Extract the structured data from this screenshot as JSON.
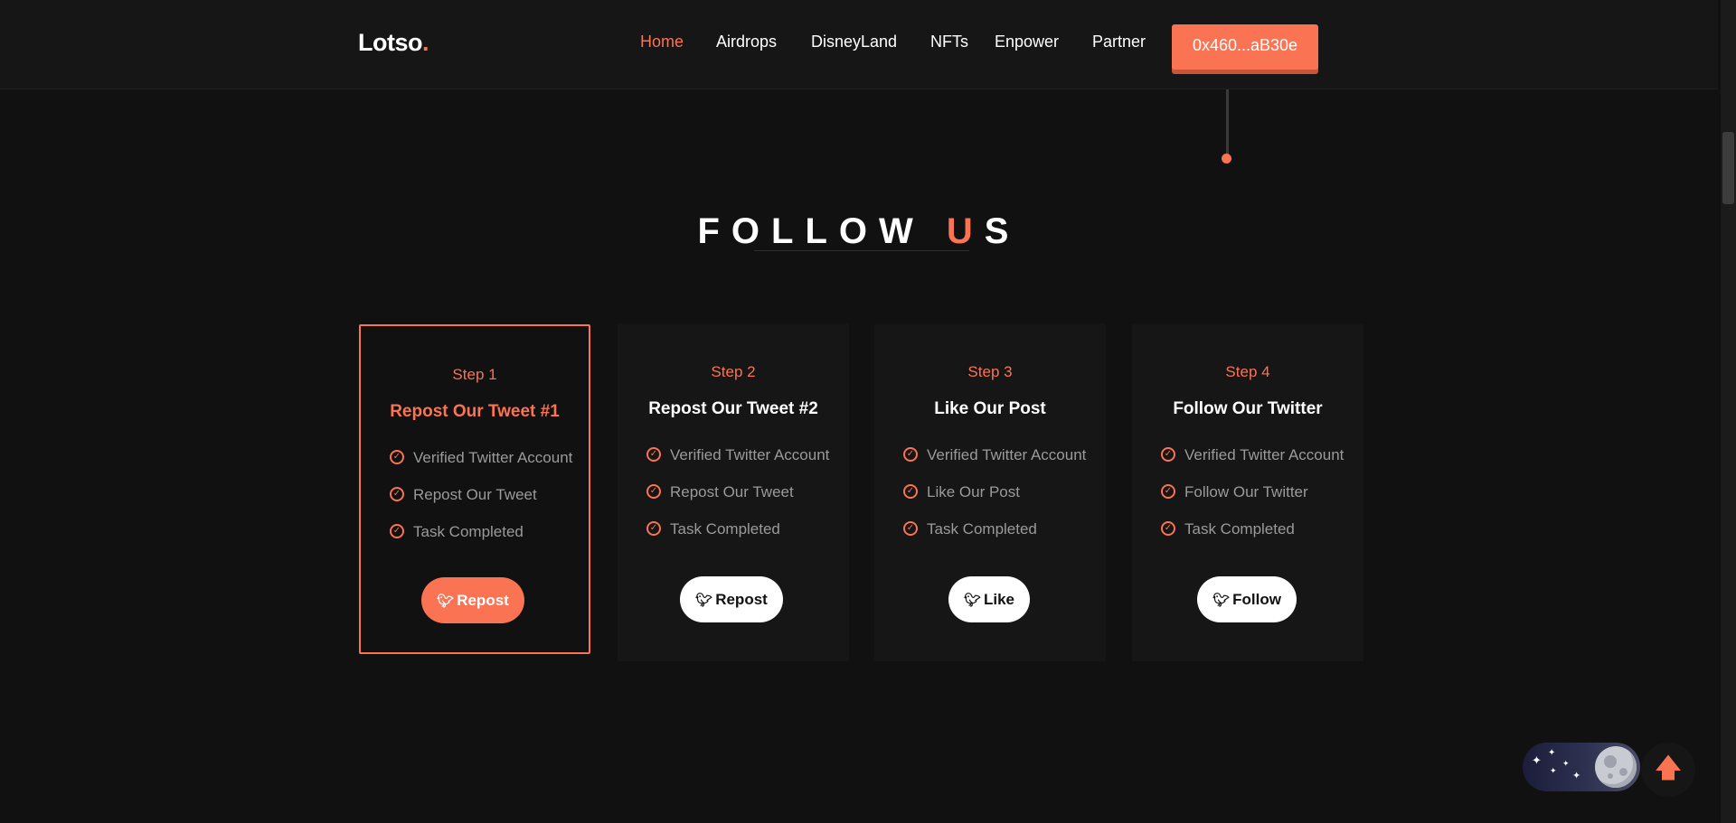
{
  "header": {
    "logo": "Lotso",
    "logo_dot": ".",
    "nav": [
      "Home",
      "Airdrops",
      "DisneyLand",
      "NFTs",
      "Enpower",
      "Partner"
    ],
    "active_nav": "Home",
    "wallet": "0x460...aB30e"
  },
  "section": {
    "title_part1": "FOLLOW",
    "title_part2a": "U",
    "title_part2b": "S"
  },
  "cards": [
    {
      "step": "Step 1",
      "title": "Repost Our Tweet #1",
      "features": [
        "Verified Twitter Account",
        "Repost Our Tweet",
        "Task Completed"
      ],
      "button": "Repost",
      "active": true
    },
    {
      "step": "Step 2",
      "title": "Repost Our Tweet #2",
      "features": [
        "Verified Twitter Account",
        "Repost Our Tweet",
        "Task Completed"
      ],
      "button": "Repost",
      "active": false
    },
    {
      "step": "Step 3",
      "title": "Like Our Post",
      "features": [
        "Verified Twitter Account",
        "Like Our Post",
        "Task Completed"
      ],
      "button": "Like",
      "active": false
    },
    {
      "step": "Step 4",
      "title": "Follow Our Twitter",
      "features": [
        "Verified Twitter Account",
        "Follow Our Twitter",
        "Task Completed"
      ],
      "button": "Follow",
      "active": false
    }
  ],
  "icons": {
    "check": "check-circle-icon",
    "button": "twitter-bird-icon",
    "theme": "moon-icon",
    "scroll_top": "arrow-up-icon"
  },
  "colors": {
    "accent": "#fa7352",
    "background": "#111111",
    "card": "#161616"
  }
}
